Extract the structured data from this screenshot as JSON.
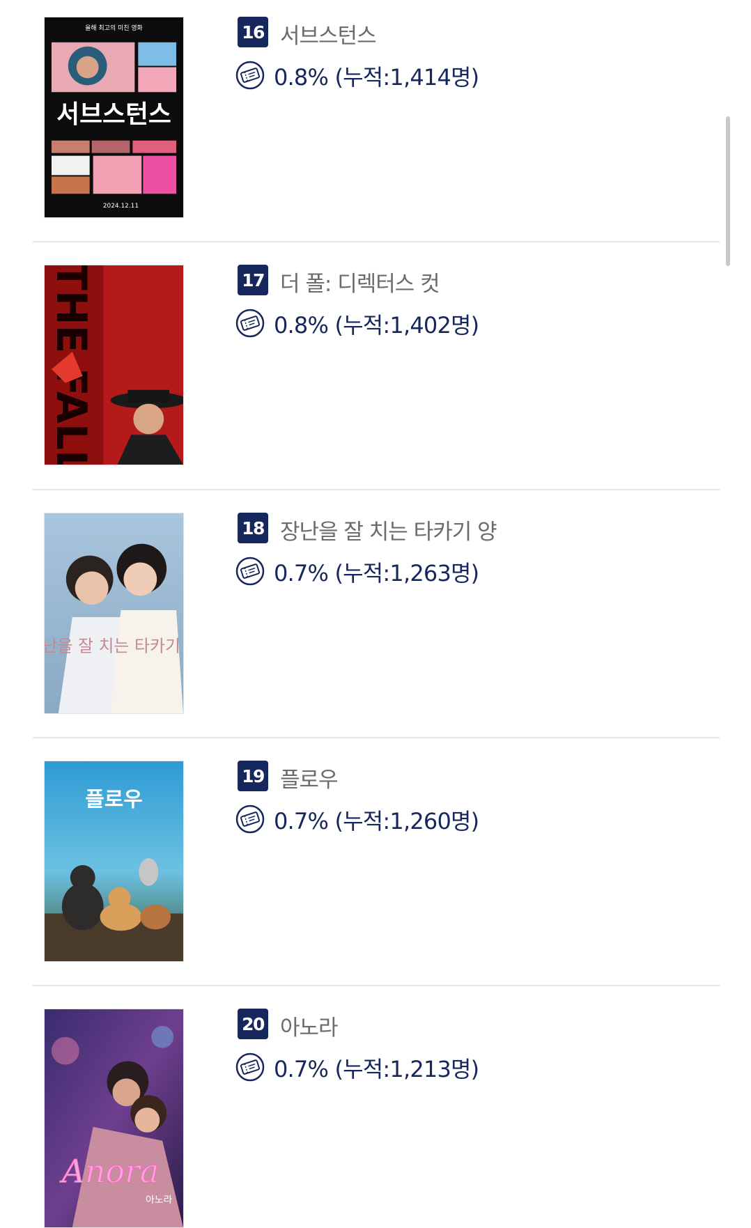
{
  "movies": [
    {
      "rank": "16",
      "title": "서브스턴스",
      "stat": "0.8% (누적:1,414명)",
      "poster_text": "서브스턴스",
      "poster_date": "2024.12.11",
      "poster_top": "올해 최고의 미친 영화"
    },
    {
      "rank": "17",
      "title": "더 폴: 디렉터스 컷",
      "stat": "0.8% (누적:1,402명)",
      "poster_text": "THE FALL"
    },
    {
      "rank": "18",
      "title": "장난을 잘 치는 타카기 양",
      "stat": "0.7% (누적:1,263명)",
      "poster_text": "장난을 잘 치는 타카기 양"
    },
    {
      "rank": "19",
      "title": "플로우",
      "stat": "0.7% (누적:1,260명)",
      "poster_text": "플로우"
    },
    {
      "rank": "20",
      "title": "아노라",
      "stat": "0.7% (누적:1,213명)",
      "poster_text": "Anora",
      "poster_sub": "아노라"
    }
  ],
  "icons": {
    "stat": "ticket-icon"
  },
  "colors": {
    "rank_bg": "#16275e",
    "stat_text": "#16275e",
    "title_text": "#6b6b6b"
  }
}
